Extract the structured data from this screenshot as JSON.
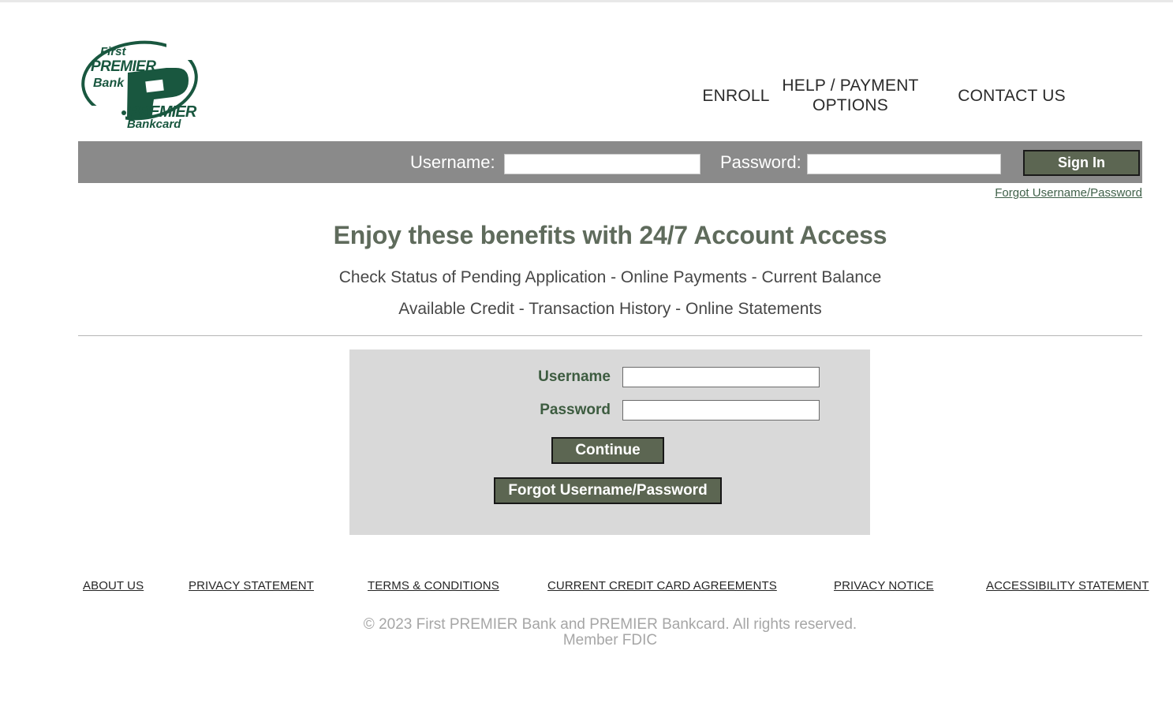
{
  "brand": {
    "logo_alt": "First PREMIER Bank / PREMIER Bankcard",
    "logo_line1": "First",
    "logo_line2": "PREMIER",
    "logo_line3": "Bank",
    "logo_mark": "P",
    "logo_line4": "PREMIER",
    "logo_line5": "Bankcard",
    "green": "#19573f"
  },
  "nav": {
    "items": [
      {
        "label": "ENROLL"
      },
      {
        "label": "HELP / PAYMENT OPTIONS"
      },
      {
        "label": "CONTACT US"
      }
    ]
  },
  "signin_bar": {
    "username_label": "Username:",
    "password_label": "Password:",
    "username_value": "",
    "password_value": "",
    "username_placeholder": "",
    "password_placeholder": "",
    "signin_button": "Sign In",
    "bar_color": "#8a8a8a",
    "button_color": "#5c6652"
  },
  "forgot_link_top": "Forgot Username/Password",
  "benefits": {
    "heading": "Enjoy these benefits with 24/7 Account Access",
    "line1": "Check Status of Pending Application - Online Payments - Current Balance",
    "line2": "Available Credit - Transaction History - Online Statements",
    "heading_color": "#5f6b5c"
  },
  "login_form": {
    "username_label": "Username",
    "password_label": "Password",
    "username_value": "",
    "password_value": "",
    "username_placeholder": "",
    "password_placeholder": "",
    "continue_button": "Continue",
    "forgot_button": "Forgot Username/Password",
    "panel_color": "#d9d9d9",
    "label_color": "#3d5c40"
  },
  "footer": {
    "links": [
      {
        "label": "ABOUT US"
      },
      {
        "label": "PRIVACY STATEMENT"
      },
      {
        "label": "TERMS & CONDITIONS"
      },
      {
        "label": "CURRENT CREDIT CARD AGREEMENTS"
      },
      {
        "label": "PRIVACY NOTICE"
      },
      {
        "label": "ACCESSIBILITY STATEMENT"
      }
    ],
    "copyright_line1": "© 2023 First PREMIER Bank and PREMIER Bankcard. All rights reserved.",
    "copyright_line2": "Member FDIC"
  }
}
